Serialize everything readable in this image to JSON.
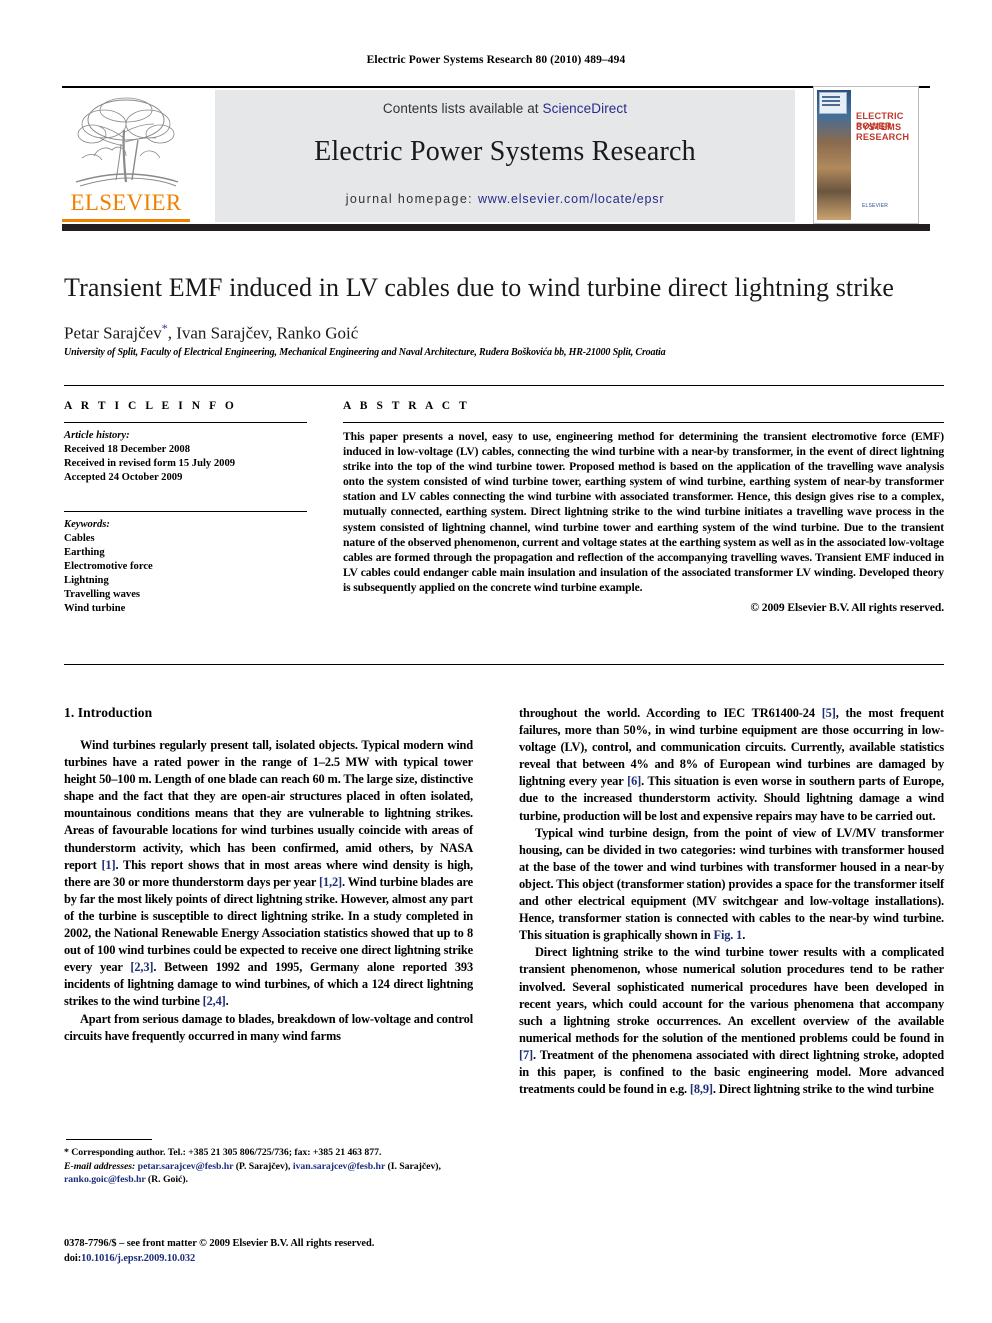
{
  "running_head": "Electric Power Systems Research 80 (2010) 489–494",
  "masthead": {
    "contents_prefix": "Contents lists available at ",
    "sciencedirect": "ScienceDirect",
    "journal_title": "Electric Power Systems Research",
    "homepage_label": "journal homepage:",
    "homepage_url": "www.elsevier.com/locate/epsr",
    "publisher_logo_text": "ELSEVIER",
    "publisher_accent_color": "#f08000",
    "link_color": "#2a2a8c",
    "banner_bg": "#e6e7e8",
    "cover": {
      "title_line1": "ELECTRIC POWER",
      "title_line2": "SYSTEMS RESEARCH",
      "publisher_mark": "ELSEVIER",
      "title_color": "#c0392b"
    }
  },
  "article": {
    "title": "Transient EMF induced in LV cables due to wind turbine direct lightning strike",
    "authors": "Petar Sarajčev",
    "corresponding_marker": "*",
    "authors_rest": ", Ivan Sarajčev, Ranko Goić",
    "affiliation": "University of Split, Faculty of Electrical Engineering, Mechanical Engineering and Naval Architecture, Ruđera Boškovića bb, HR-21000 Split, Croatia"
  },
  "article_info": {
    "kicker": "A R T I C L E    I N F O",
    "history_label": "Article history:",
    "history": [
      "Received 18 December 2008",
      "Received in revised form 15 July 2009",
      "Accepted 24 October 2009"
    ],
    "keywords_label": "Keywords:",
    "keywords": [
      "Cables",
      "Earthing",
      "Electromotive force",
      "Lightning",
      "Travelling waves",
      "Wind turbine"
    ]
  },
  "abstract": {
    "kicker": "A B S T R A C T",
    "text": "This paper presents a novel, easy to use, engineering method for determining the transient electromotive force (EMF) induced in low-voltage (LV) cables, connecting the wind turbine with a near-by transformer, in the event of direct lightning strike into the top of the wind turbine tower. Proposed method is based on the application of the travelling wave analysis onto the system consisted of wind turbine tower, earthing system of wind turbine, earthing system of near-by transformer station and LV cables connecting the wind turbine with associated transformer. Hence, this design gives rise to a complex, mutually connected, earthing system. Direct lightning strike to the wind turbine initiates a travelling wave process in the system consisted of lightning channel, wind turbine tower and earthing system of the wind turbine. Due to the transient nature of the observed phenomenon, current and voltage states at the earthing system as well as in the associated low-voltage cables are formed through the propagation and reflection of the accompanying travelling waves. Transient EMF induced in LV cables could endanger cable main insulation and insulation of the associated transformer LV winding. Developed theory is subsequently applied on the concrete wind turbine example.",
    "copyright": "© 2009 Elsevier B.V. All rights reserved."
  },
  "body": {
    "section_heading": "1.  Introduction",
    "left_paragraphs": [
      {
        "indent": true,
        "parts": [
          {
            "t": "Wind turbines regularly present tall, isolated objects. Typical modern wind turbines have a rated power in the range of 1–2.5 MW with typical tower height 50–100 m. Length of one blade can reach 60 m. The large size, distinctive shape and the fact that they are open-air structures placed in often isolated, mountainous conditions means that they are vulnerable to lightning strikes. Areas of favourable locations for wind turbines usually coincide with areas of thunderstorm activity, which has been confirmed, amid others, by NASA report "
          },
          {
            "t": "[1]",
            "ref": true
          },
          {
            "t": ". This report shows that in most areas where wind density is high, there are 30 or more thunderstorm days per year "
          },
          {
            "t": "[1,2]",
            "ref": true
          },
          {
            "t": ". Wind turbine blades are by far the most likely points of direct lightning strike. However, almost any part of the turbine is susceptible to direct lightning strike. In a study completed in 2002, the National Renewable Energy Association statistics showed that up to 8 out of 100 wind turbines could be expected to receive one direct lightning strike every year "
          },
          {
            "t": "[2,3]",
            "ref": true
          },
          {
            "t": ". Between 1992 and 1995, Germany alone reported 393 incidents of lightning damage to wind turbines, of which a 124 direct lightning strikes to the wind turbine "
          },
          {
            "t": "[2,4]",
            "ref": true
          },
          {
            "t": "."
          }
        ]
      },
      {
        "indent": true,
        "parts": [
          {
            "t": "Apart from serious damage to blades, breakdown of low-voltage and control circuits have frequently occurred in many wind farms"
          }
        ]
      }
    ],
    "right_paragraphs": [
      {
        "indent": false,
        "parts": [
          {
            "t": "throughout the world. According to IEC TR61400-24 "
          },
          {
            "t": "[5]",
            "ref": true
          },
          {
            "t": ", the most frequent failures, more than 50%, in wind turbine equipment are those occurring in low-voltage (LV), control, and communication circuits. Currently, available statistics reveal that between 4% and 8% of European wind turbines are damaged by lightning every year "
          },
          {
            "t": "[6]",
            "ref": true
          },
          {
            "t": ". This situation is even worse in southern parts of Europe, due to the increased thunderstorm activity. Should lightning damage a wind turbine, production will be lost and expensive repairs may have to be carried out."
          }
        ]
      },
      {
        "indent": true,
        "parts": [
          {
            "t": "Typical wind turbine design, from the point of view of LV/MV transformer housing, can be divided in two categories: wind turbines with transformer housed at the base of the tower and wind turbines with transformer housed in a near-by object. This object (transformer station) provides a space for the transformer itself and other electrical equipment (MV switchgear and low-voltage installations). Hence, transformer station is connected with cables to the near-by wind turbine. This situation is graphically shown in "
          },
          {
            "t": "Fig. 1",
            "ref": true
          },
          {
            "t": "."
          }
        ]
      },
      {
        "indent": true,
        "parts": [
          {
            "t": "Direct lightning strike to the wind turbine tower results with a complicated transient phenomenon, whose numerical solution procedures tend to be rather involved. Several sophisticated numerical procedures have been developed in recent years, which could account for the various phenomena that accompany such a lightning stroke occurrences. An excellent overview of the available numerical methods for the solution of the mentioned problems could be found in "
          },
          {
            "t": "[7]",
            "ref": true
          },
          {
            "t": ". Treatment of the phenomena associated with direct lightning stroke, adopted in this paper, is confined to the basic engineering model. More advanced treatments could be found in e.g. "
          },
          {
            "t": "[8,9]",
            "ref": true
          },
          {
            "t": ". Direct lightning strike to the wind turbine"
          }
        ]
      }
    ]
  },
  "footnotes": {
    "corresponding": "*  Corresponding author. Tel.: +385 21 305 806/725/736; fax: +385 21 463 877.",
    "email_label": "E-mail addresses:",
    "emails": [
      {
        "address": "petar.sarajcev@fesb.hr",
        "owner": "(P. Sarajčev)"
      },
      {
        "address": "ivan.sarajcev@fesb.hr",
        "owner": "(I. Sarajčev)"
      },
      {
        "address": "ranko.goic@fesb.hr",
        "owner": "(R. Goić)"
      }
    ],
    "issn_line": "0378-7796/$ – see front matter © 2009 Elsevier B.V. All rights reserved.",
    "doi_label": "doi:",
    "doi_value": "10.1016/j.epsr.2009.10.032"
  }
}
